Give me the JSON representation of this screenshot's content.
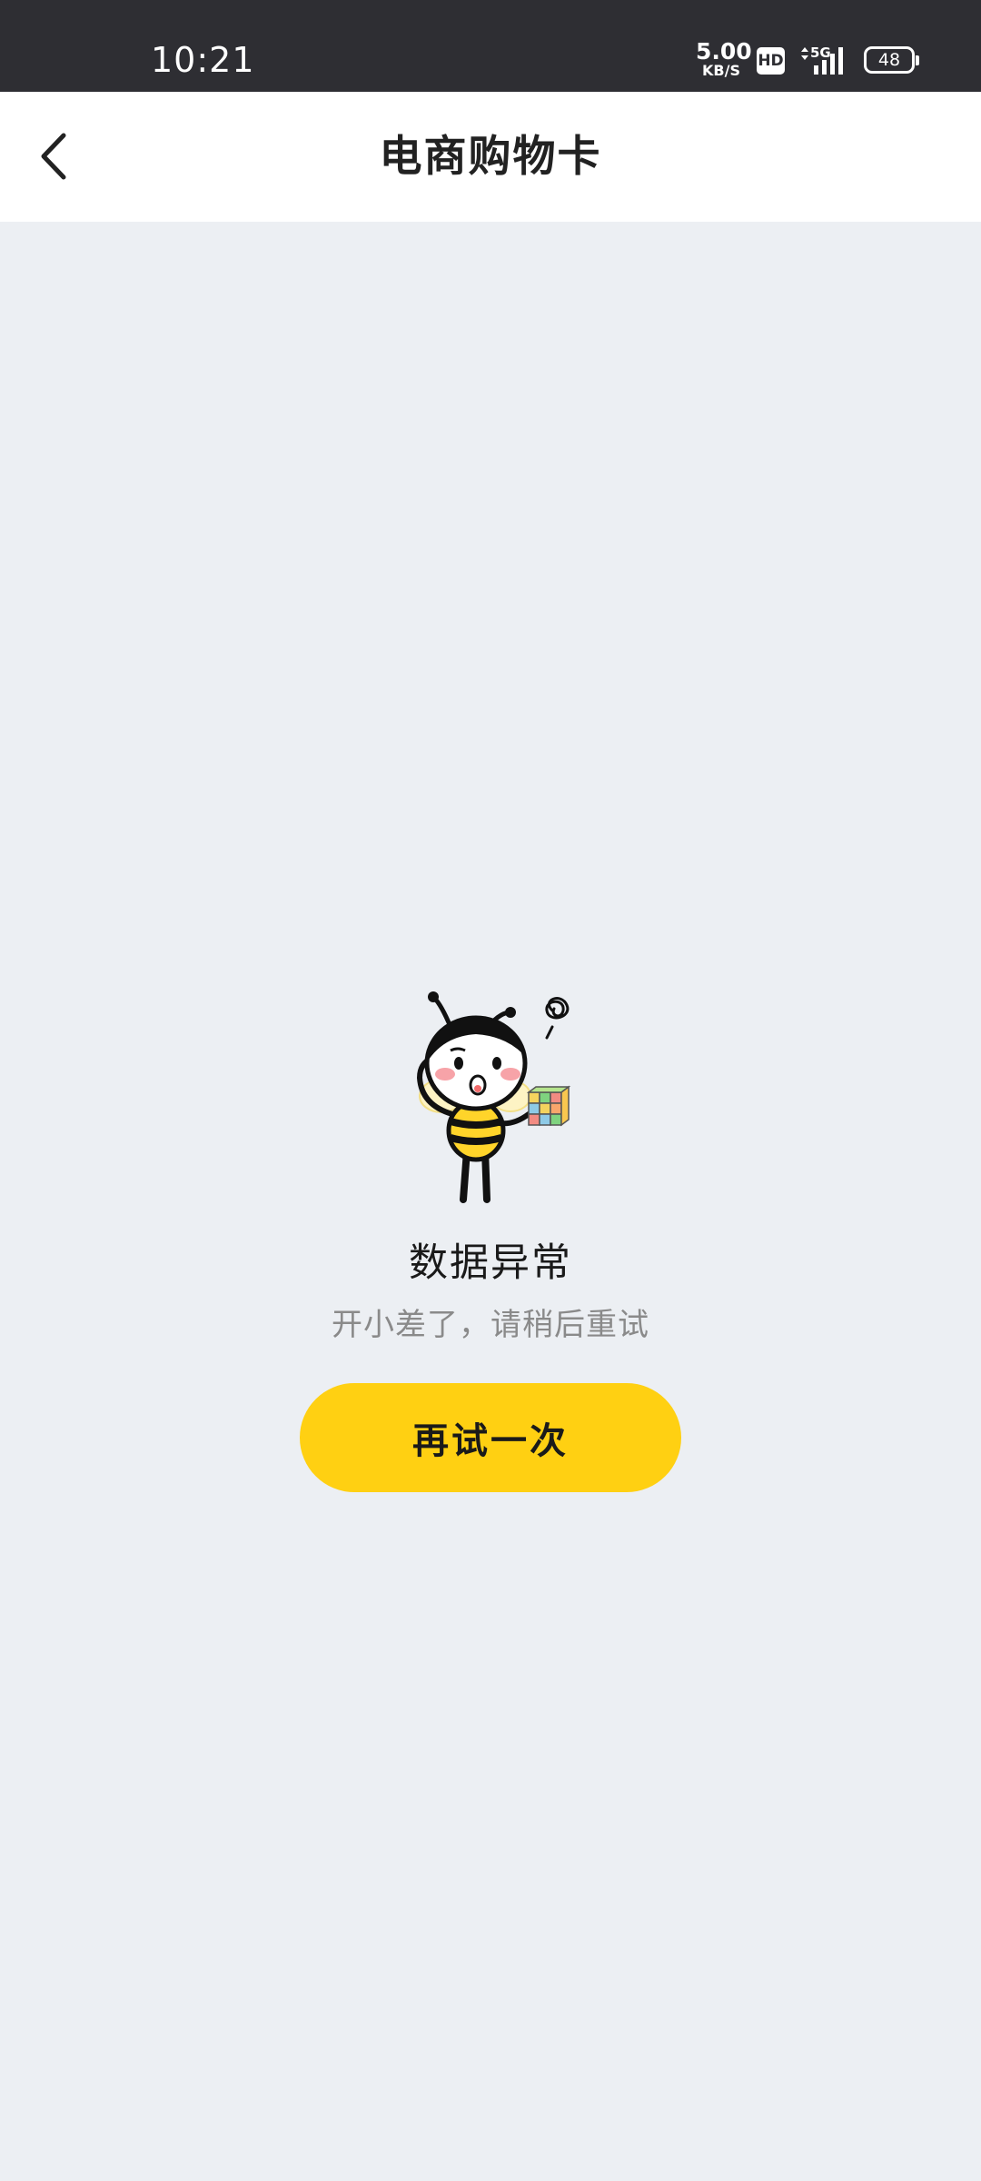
{
  "status_bar": {
    "time": "10:21",
    "net_speed_value": "5.00",
    "net_speed_unit": "KB/S",
    "hd_label": "HD",
    "network_label": "5G",
    "battery_level": "48"
  },
  "header": {
    "title": "电商购物卡",
    "back_icon": "chevron-left-icon"
  },
  "empty_state": {
    "illustration": "bee-mascot-illustration",
    "title": "数据异常",
    "subtitle": "开小差了，请稍后重试",
    "retry_label": "再试一次"
  },
  "colors": {
    "status_bar_bg": "#2e2e33",
    "page_bg": "#eceff3",
    "button_accent": "#ffd012"
  }
}
